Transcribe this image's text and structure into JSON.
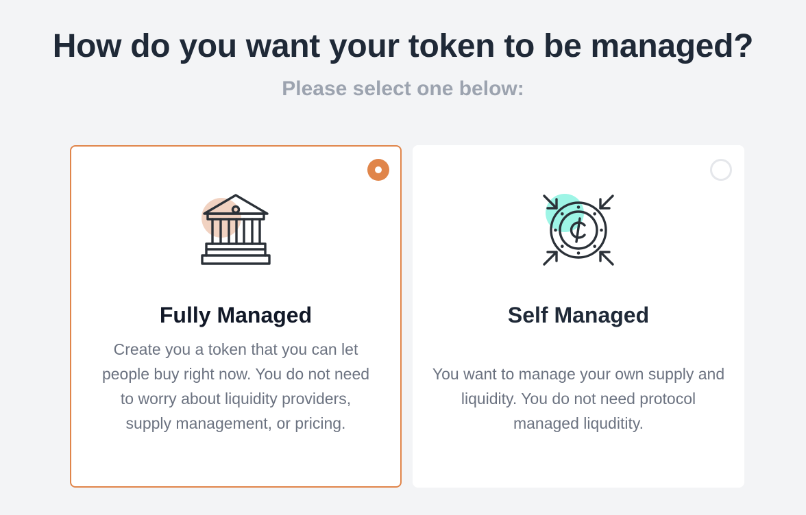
{
  "header": {
    "title": "How do you want your token to be managed?",
    "subtitle": "Please select one below:"
  },
  "options": [
    {
      "id": "fully",
      "title": "Fully Managed",
      "description": "Create you a token that you can let people buy right now. You do not need to worry about liquidity providers, supply management, or pricing.",
      "selected": true,
      "icon": "bank-icon",
      "accent_color": "#f1d2c1"
    },
    {
      "id": "self",
      "title": "Self Managed",
      "description": "You want to manage your own supply and liquidity. You do not need protocol managed liquditity.",
      "selected": false,
      "icon": "coin-arrows-icon",
      "accent_color": "#9ef5e6"
    }
  ],
  "colors": {
    "selected_border": "#e0854a",
    "background": "#f3f4f6",
    "title_text": "#1f2937",
    "subtitle_text": "#9ca3af",
    "body_text": "#6b7280",
    "icon_stroke": "#2b3138"
  }
}
